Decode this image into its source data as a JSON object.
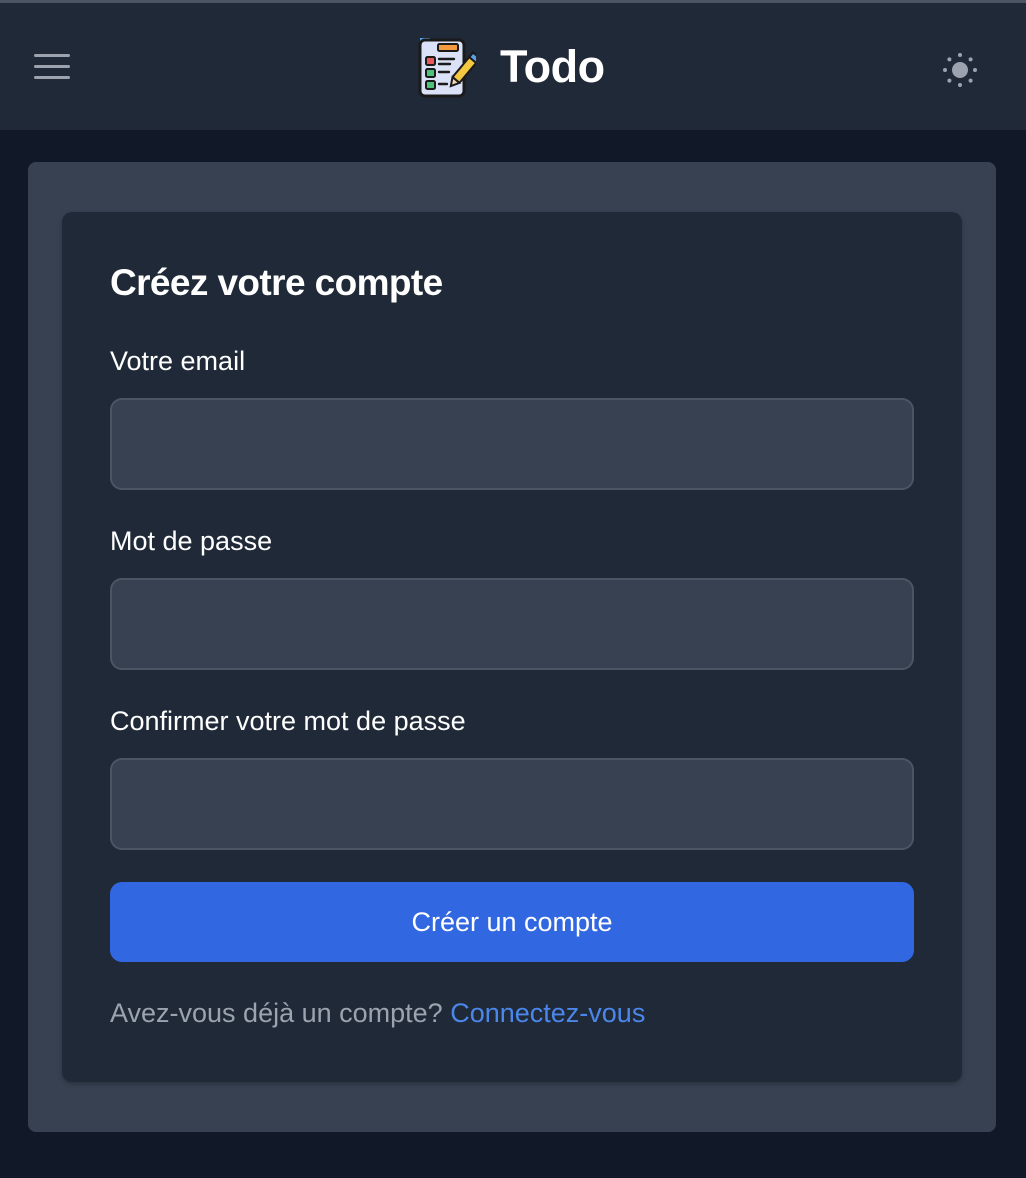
{
  "header": {
    "brand_name": "Todo",
    "menu_icon": "hamburger-menu-icon",
    "logo_icon": "checklist-clipboard-icon",
    "theme_icon": "sun-icon"
  },
  "signup": {
    "title": "Créez votre compte",
    "email_label": "Votre email",
    "email_value": "",
    "password_label": "Mot de passe",
    "password_value": "",
    "confirm_label": "Confirmer votre mot de passe",
    "confirm_value": "",
    "submit_label": "Créer un compte",
    "footer_prompt": "Avez-vous déjà un compte?",
    "footer_link": "Connectez-vous"
  },
  "colors": {
    "background": "#111827",
    "navbar": "#1f2937",
    "panel": "#374151",
    "card": "#1f2937",
    "input_bg": "#374151",
    "primary_button": "#3168e2",
    "link": "#4b87ea",
    "muted_text": "#9ca3af"
  }
}
